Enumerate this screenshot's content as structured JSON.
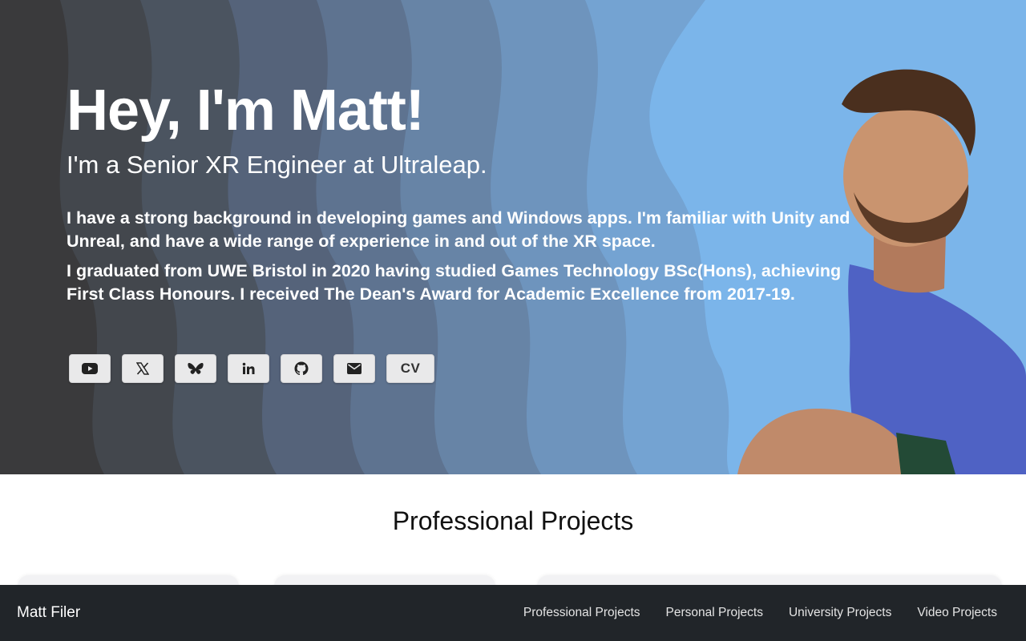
{
  "hero": {
    "title": "Hey, I'm Matt!",
    "subtitle": "I'm a Senior XR Engineer at Ultraleap.",
    "paragraph1": "I have a strong background in developing games and Windows apps. I'm familiar with Unity and Unreal, and have a wide range of experience in and out of the XR space.",
    "paragraph2": "I graduated from UWE Bristol in 2020 having studied Games Technology BSc(Hons), achieving First Class Honours. I received The Dean's Award for Academic Excellence from 2017-19.",
    "social": [
      {
        "icon": "youtube-icon"
      },
      {
        "icon": "x-twitter-icon"
      },
      {
        "icon": "bluesky-icon"
      },
      {
        "icon": "linkedin-icon"
      },
      {
        "icon": "github-icon"
      },
      {
        "icon": "email-icon"
      },
      {
        "label": "CV"
      }
    ]
  },
  "section": {
    "title": "Professional Projects"
  },
  "navbar": {
    "brand": "Matt Filer",
    "links": [
      "Professional Projects",
      "Personal Projects",
      "University Projects",
      "Video Projects"
    ]
  },
  "colors": {
    "hero_dark": "#3a3a3c",
    "hero_light_blue": "#7bb5ea",
    "navbar_bg": "#212529",
    "button_bg": "#e9e9ea"
  }
}
